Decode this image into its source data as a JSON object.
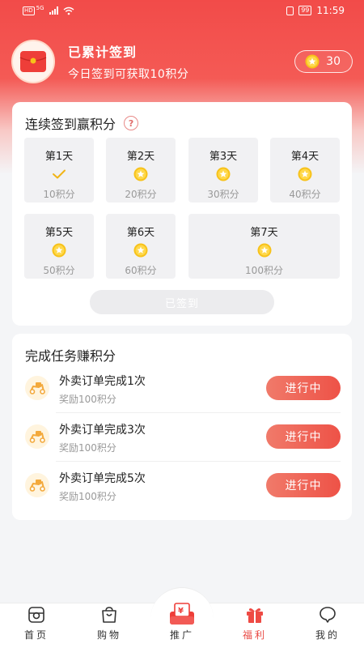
{
  "status_bar": {
    "network": "HD",
    "network_type": "5G",
    "battery": "99",
    "time": "11:59"
  },
  "header": {
    "title": "已累计签到",
    "subtitle": "今日签到可获取10积分",
    "coins": "30"
  },
  "checkin": {
    "title": "连续签到赢积分",
    "help": "?",
    "days": [
      {
        "label": "第1天",
        "points": "10积分",
        "status": "signed"
      },
      {
        "label": "第2天",
        "points": "20积分",
        "status": "coin"
      },
      {
        "label": "第3天",
        "points": "30积分",
        "status": "coin"
      },
      {
        "label": "第4天",
        "points": "40积分",
        "status": "coin"
      },
      {
        "label": "第5天",
        "points": "50积分",
        "status": "coin"
      },
      {
        "label": "第6天",
        "points": "60积分",
        "status": "coin"
      },
      {
        "label": "第7天",
        "points": "100积分",
        "status": "coin"
      }
    ],
    "button_label": "已签到"
  },
  "tasks": {
    "title": "完成任务赚积分",
    "items": [
      {
        "name": "外卖订单完成1次",
        "reward": "奖励100积分",
        "button": "进行中"
      },
      {
        "name": "外卖订单完成3次",
        "reward": "奖励100积分",
        "button": "进行中"
      },
      {
        "name": "外卖订单完成5次",
        "reward": "奖励100积分",
        "button": "进行中"
      }
    ]
  },
  "nav": {
    "items": [
      {
        "label": "首页",
        "icon": "home-icon"
      },
      {
        "label": "购物",
        "icon": "shopping-bag-icon"
      },
      {
        "label": "推广",
        "icon": "promo-yen-icon"
      },
      {
        "label": "福利",
        "icon": "gift-icon",
        "active": true
      },
      {
        "label": "我的",
        "icon": "profile-chat-icon"
      }
    ]
  },
  "colors": {
    "brand": "#f24b49",
    "coin": "#f7c21a",
    "button": "#ee5247"
  }
}
